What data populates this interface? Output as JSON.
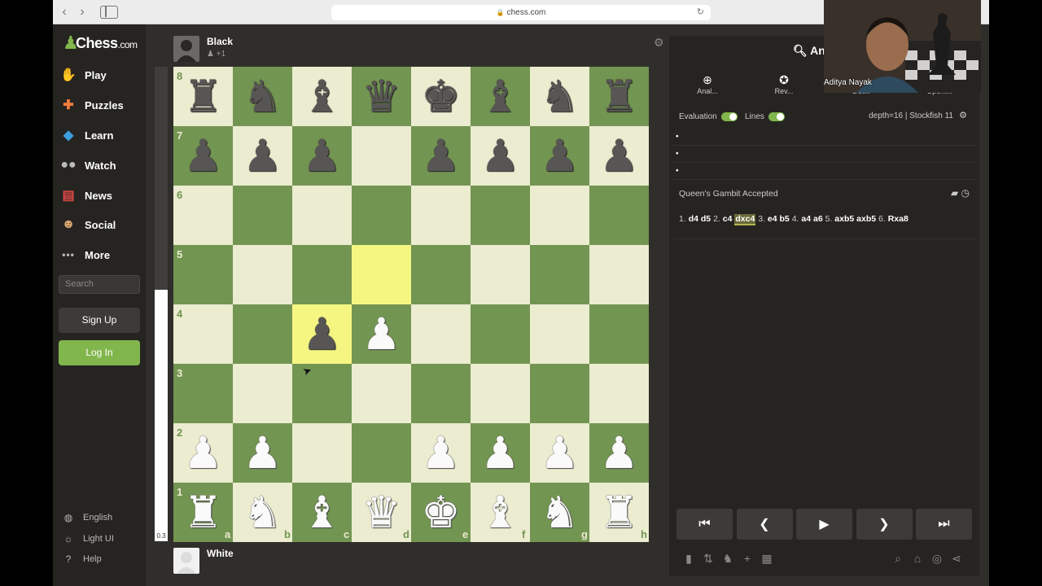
{
  "browser": {
    "url": "chess.com"
  },
  "nav": {
    "logo_main": "Chess",
    "logo_suffix": ".com",
    "items": [
      {
        "label": "Play",
        "icon": "pawn-hand-icon"
      },
      {
        "label": "Puzzles",
        "icon": "puzzle-icon"
      },
      {
        "label": "Learn",
        "icon": "graduation-cap-icon"
      },
      {
        "label": "Watch",
        "icon": "binoculars-icon"
      },
      {
        "label": "News",
        "icon": "newspaper-icon"
      },
      {
        "label": "Social",
        "icon": "people-icon"
      },
      {
        "label": "More",
        "icon": "dots-icon"
      }
    ],
    "search_placeholder": "Search",
    "signup": "Sign Up",
    "login": "Log In",
    "footer": [
      {
        "label": "English",
        "icon": "globe-icon"
      },
      {
        "label": "Light UI",
        "icon": "sun-icon"
      },
      {
        "label": "Help",
        "icon": "help-icon"
      }
    ]
  },
  "top_player": {
    "name": "Black",
    "material": "+1"
  },
  "bottom_player": {
    "name": "White"
  },
  "eval": {
    "score": "0.3",
    "white_fraction": 0.53
  },
  "board": {
    "ranks": [
      "8",
      "7",
      "6",
      "5",
      "4",
      "3",
      "2",
      "1"
    ],
    "files": [
      "a",
      "b",
      "c",
      "d",
      "e",
      "f",
      "g",
      "h"
    ],
    "light_color": "#ebecd0",
    "dark_color": "#739552",
    "highlight_color": "#f5f682",
    "highlighted": [
      "d5",
      "c4"
    ],
    "position": [
      "rnbqkbnr",
      "ppp.pppp",
      "........",
      "........",
      "..pP....",
      "........",
      "PP..PPPP",
      "RNBQKBNR"
    ]
  },
  "analysis": {
    "title": "An",
    "tabs": [
      {
        "label": "Anal...",
        "icon": "magnifier-icon"
      },
      {
        "label": "Rev...",
        "icon": "star-icon"
      },
      {
        "label": "Det...",
        "icon": "detail-icon"
      },
      {
        "label": "Openi...",
        "icon": "book-icon"
      }
    ],
    "evaluation_label": "Evaluation",
    "lines_label": "Lines",
    "engine_info": "depth=16 | Stockfish 11",
    "opening_name": "Queen's Gambit Accepted",
    "moves": [
      {
        "num": "1.",
        "white": "d4",
        "black": "d5"
      },
      {
        "num": "2.",
        "white": "c4",
        "black": "dxc4",
        "current": "black"
      },
      {
        "num": "3.",
        "white": "e4",
        "black": "b5"
      },
      {
        "num": "4.",
        "white": "a4",
        "black": "a6"
      },
      {
        "num": "5.",
        "white": "axb5",
        "black": "axb5"
      },
      {
        "num": "6.",
        "white": "Rxa8",
        "black": ""
      }
    ]
  },
  "webcam": {
    "name": "Aditya Nayak"
  }
}
